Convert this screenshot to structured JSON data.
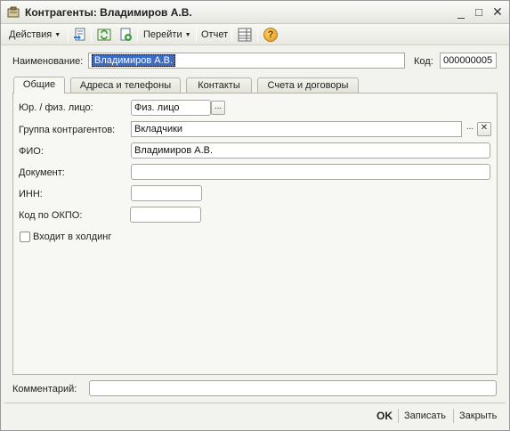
{
  "window": {
    "title": "Контрагенты: Владимиров А.В.",
    "minimize": "_",
    "maximize": "□",
    "close": "✕"
  },
  "toolbar": {
    "actions_label": "Действия",
    "goto_label": "Перейти",
    "report_label": "Отчет",
    "help_glyph": "?"
  },
  "header": {
    "name_label": "Наименование:",
    "name_value": "Владимиров А.В.",
    "code_label": "Код:",
    "code_value": "000000005"
  },
  "tabs": [
    {
      "label": "Общие"
    },
    {
      "label": "Адреса и телефоны"
    },
    {
      "label": "Контакты"
    },
    {
      "label": "Счета и договоры"
    }
  ],
  "general": {
    "legal_type_label": "Юр. / физ. лицо:",
    "legal_type_value": "Физ. лицо",
    "group_label": "Группа контрагентов:",
    "group_value": "Вкладчики",
    "fio_label": "ФИО:",
    "fio_value": "Владимиров А.В.",
    "document_label": "Документ:",
    "document_value": "",
    "inn_label": "ИНН:",
    "inn_value": "",
    "okpo_label": "Код по ОКПО:",
    "okpo_value": "",
    "holding_label": "Входит в холдинг",
    "holding_checked": false,
    "ellipsis": "...",
    "clear_glyph": "✕"
  },
  "comment": {
    "label": "Комментарий:",
    "value": ""
  },
  "footer": {
    "ok_label": "OK",
    "save_label": "Записать",
    "close_label": "Закрыть"
  }
}
